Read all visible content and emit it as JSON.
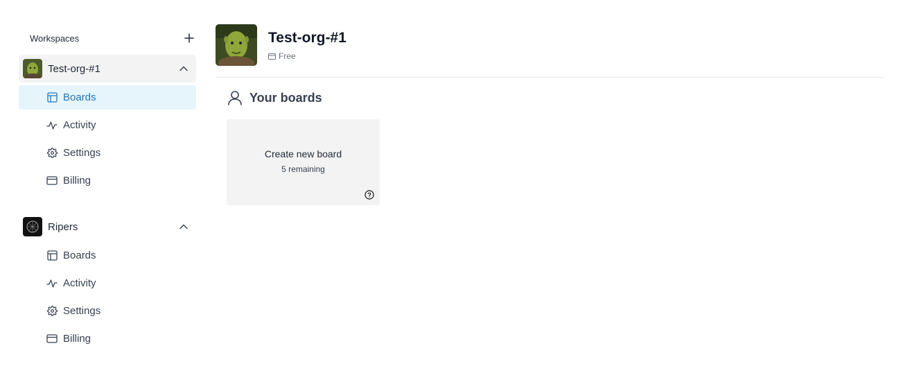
{
  "sidebar": {
    "workspaces_title": "Workspaces",
    "orgs": [
      {
        "name": "Test-org-#1",
        "items": [
          {
            "label": "Boards",
            "icon": "boards-icon"
          },
          {
            "label": "Activity",
            "icon": "activity-icon"
          },
          {
            "label": "Settings",
            "icon": "gear-icon"
          },
          {
            "label": "Billing",
            "icon": "credit-card-icon"
          }
        ]
      },
      {
        "name": "Ripers",
        "items": [
          {
            "label": "Boards",
            "icon": "boards-icon"
          },
          {
            "label": "Activity",
            "icon": "activity-icon"
          },
          {
            "label": "Settings",
            "icon": "gear-icon"
          },
          {
            "label": "Billing",
            "icon": "credit-card-icon"
          }
        ]
      }
    ]
  },
  "main": {
    "title": "Test-org-#1",
    "plan": "Free",
    "section_title": "Your boards",
    "create_card": {
      "label": "Create new board",
      "remaining": "5 remaining"
    }
  },
  "colors": {
    "accent": "#2378b8",
    "selected_bg": "#e6f4fb",
    "card_bg": "#f3f3f3"
  }
}
